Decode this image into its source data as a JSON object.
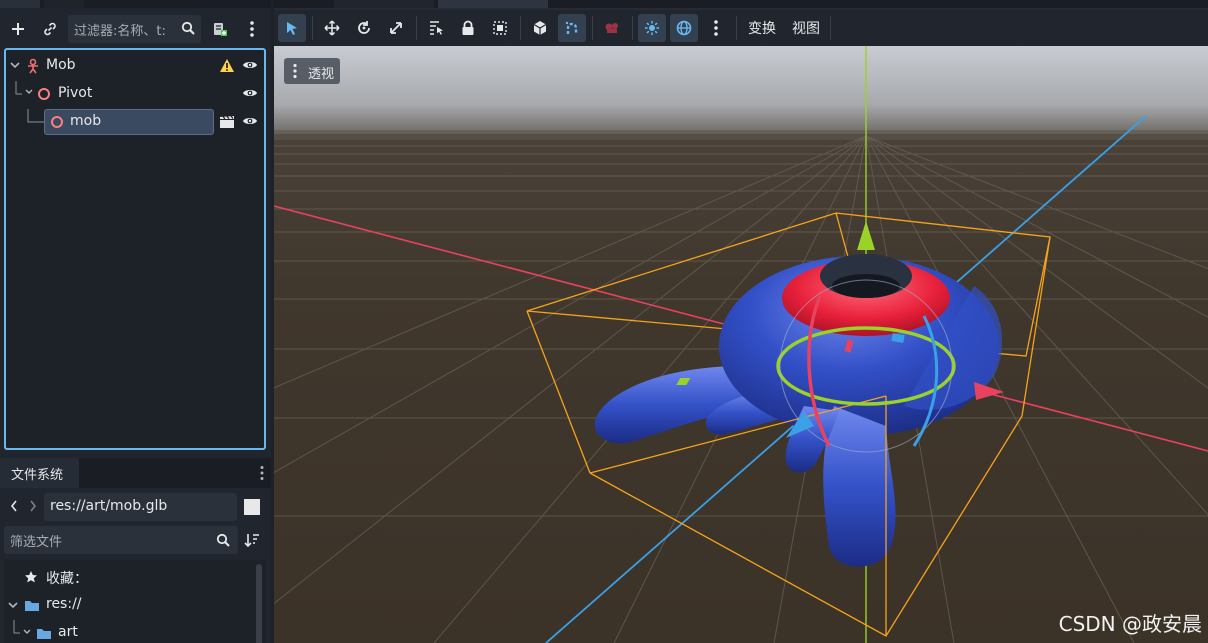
{
  "scene_dock": {
    "filter_placeholder": "过滤器:名称、t:",
    "nodes": [
      {
        "name": "Mob",
        "icon": "character-body-icon",
        "warning": true
      },
      {
        "name": "Pivot",
        "icon": "node3d-icon"
      },
      {
        "name": "mob",
        "icon": "node3d-icon",
        "selected": true,
        "has_scene_icon": true
      }
    ]
  },
  "filesystem_dock": {
    "tab_label": "文件系统",
    "path": "res://art/mob.glb",
    "search_placeholder": "筛选文件",
    "items": [
      {
        "label": "收藏：",
        "icon": "star-icon"
      },
      {
        "label": "res://",
        "icon": "folder-icon"
      },
      {
        "label": "art",
        "icon": "folder-icon"
      }
    ]
  },
  "viewport_toolbar": {
    "menus": [
      "变换",
      "视图"
    ]
  },
  "viewport": {
    "perspective_label": "透视"
  },
  "watermark": "CSDN @政安晨",
  "colors": {
    "accent": "#6ab8f0",
    "axis_x": "#e8425e",
    "axis_y": "#9ad22a",
    "axis_z": "#3aa0e8",
    "bounding_box": "#f5a31c",
    "mob_body": "#2c47b8",
    "mob_ring": "#e6203a"
  }
}
